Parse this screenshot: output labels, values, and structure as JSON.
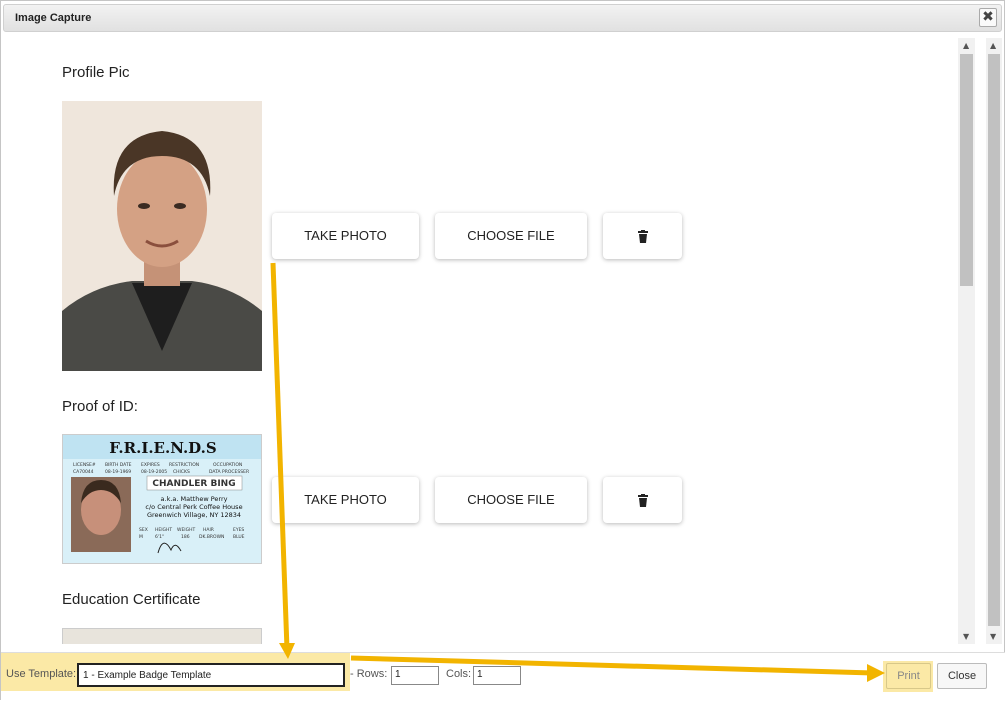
{
  "dialog": {
    "title": "Image Capture"
  },
  "sections": [
    {
      "label": "Profile Pic",
      "take_photo": "TAKE PHOTO",
      "choose_file": "CHOOSE FILE"
    },
    {
      "label": "Proof of ID:",
      "take_photo": "TAKE PHOTO",
      "choose_file": "CHOOSE FILE"
    },
    {
      "label": "Education Certificate"
    }
  ],
  "id_card": {
    "header": "F.R.I.E.N.D.S",
    "fields": [
      "LICENSE#",
      "BIRTH DATE",
      "EXPIRES",
      "RESTRICTION",
      "OCCUPATION"
    ],
    "values": [
      "CA70044",
      "08-19-1969",
      "08-19-2005",
      "CHICKS",
      "DATA PROCESSER"
    ],
    "name": "CHANDLER BING",
    "aka": "a.k.a. Matthew Perry",
    "address1": "c/o Central Perk Coffee House",
    "address2": "Greenwich Village, NY 12834",
    "stats_labels": [
      "SEX",
      "HEIGHT",
      "WEIGHT",
      "HAIR",
      "EYES"
    ],
    "stats_values": [
      "M",
      "6'1\"",
      "186",
      "DK.BROWN",
      "BLUE"
    ]
  },
  "footer": {
    "use_template_label": "Use Template:",
    "template_value": "1 - Example Badge Template",
    "rows_label": "- Rows:",
    "rows_value": "1",
    "cols_label": "Cols:",
    "cols_value": "1",
    "print_label": "Print",
    "close_label": "Close"
  },
  "colors": {
    "highlight": "#fbe9a6",
    "arrow": "#f2b400"
  }
}
